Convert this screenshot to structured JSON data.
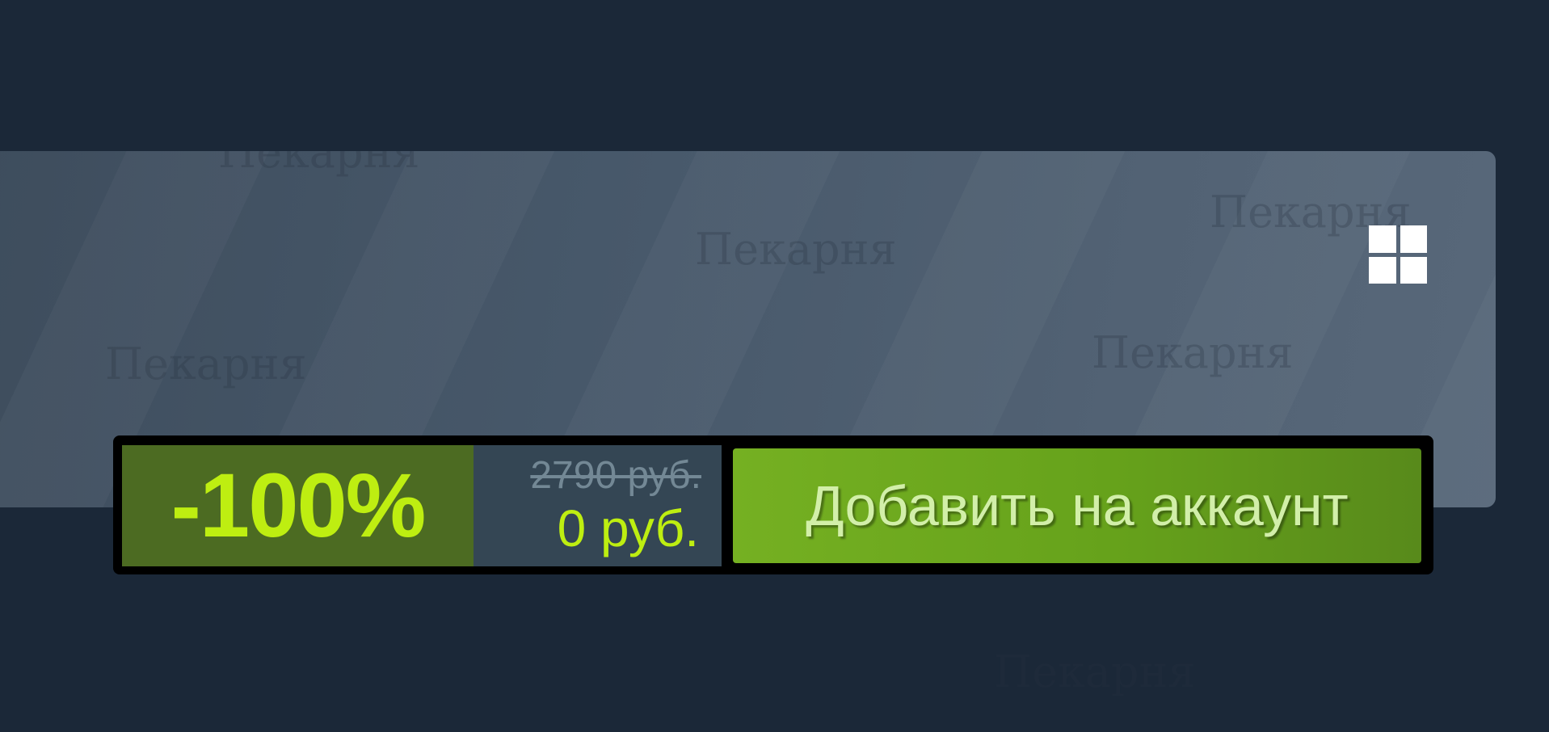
{
  "purchase": {
    "discount": "-100%",
    "original_price": "2790 руб.",
    "final_price": "0 руб.",
    "add_button_label": "Добавить на аккаунт",
    "platform_icon": "windows-icon"
  },
  "watermark_text": "Пекарня",
  "colors": {
    "page_background": "#1b2838",
    "discount_background": "#4c6b22",
    "discount_text": "#beee11",
    "price_background": "#344654",
    "original_price_text": "#738895",
    "button_green": "#75b022",
    "button_text": "#d2efa9"
  }
}
